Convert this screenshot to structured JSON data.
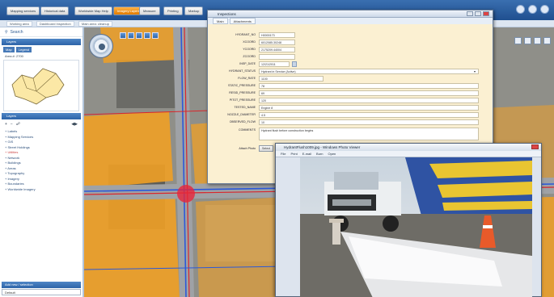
{
  "nav": {
    "buttons": [
      "Mapping services",
      "Historical data",
      "Worldwide Map Help",
      "Imagery Layers",
      "Measure",
      "Printing",
      "Markup"
    ],
    "active_index": 3
  },
  "subbar": {
    "crumbs": [
      "Working area",
      "Dashboard Inspection",
      "Main area: cleanup"
    ]
  },
  "left": {
    "search_label": "Search",
    "panel_title": "Layers",
    "tabs": [
      "Map",
      "Legend"
    ],
    "locator_label": "Area #: 2700",
    "layers_title": "Layers",
    "layers": [
      {
        "label": "+ Labels",
        "hl": false
      },
      {
        "label": "+ Mapping Services",
        "hl": false
      },
      {
        "label": "+ GIS",
        "hl": false
      },
      {
        "label": "+ Street Holdings",
        "hl": false
      },
      {
        "label": "+ Utilities",
        "hl": true
      },
      {
        "label": "+ Network",
        "hl": false
      },
      {
        "label": "+ Buildings",
        "hl": false
      },
      {
        "label": "+ Areas",
        "hl": false
      },
      {
        "label": "+ Topography",
        "hl": false
      },
      {
        "label": "+ Imagery",
        "hl": false
      },
      {
        "label": "+ Boundaries",
        "hl": false
      },
      {
        "label": "+ Worldwide Imagery",
        "hl": false
      }
    ],
    "bottom_title": "Add new / selection",
    "bottom_value": "Default"
  },
  "dialog": {
    "title": "Inspections",
    "tabs": [
      "Main",
      "Attachments"
    ],
    "fields": [
      {
        "label": "HYDRANT_NO",
        "value": "H0000173"
      },
      {
        "label": "XCOORD",
        "value": "6012085.30248"
      },
      {
        "label": "YCOORD",
        "value": "2175209.44004"
      },
      {
        "label": "ZCOORD",
        "value": ""
      },
      {
        "label": "INSP_DATE",
        "value": "12/21/2011"
      },
      {
        "label": "HYDRANT_STATUS",
        "value": "Hydrant in Service (Active)"
      },
      {
        "label": "FLOW_RATE",
        "value": "1100"
      },
      {
        "label": "STATIC_PRESSURE",
        "value": "78"
      },
      {
        "label": "RESID_PRESSURE",
        "value": "69"
      },
      {
        "label": "PITOT_PRESSURE",
        "value": "120"
      },
      {
        "label": "TESTED_NAME",
        "value": "Engine 8"
      },
      {
        "label": "NOZZLE_DIAMETER",
        "value": "4.5"
      },
      {
        "label": "OBSERVED_FLOW",
        "value": "10"
      }
    ],
    "comments_label": "COMMENTS",
    "comments_value": "Hydrant flush before construction begins",
    "attach_label": "Attach Photo",
    "attach_button": "Select"
  },
  "viewer": {
    "title": "HydrantFlush1009.jpg - Windows Photo Viewer",
    "menu": [
      "File",
      "Print",
      "E-mail",
      "Burn",
      "Open"
    ]
  }
}
